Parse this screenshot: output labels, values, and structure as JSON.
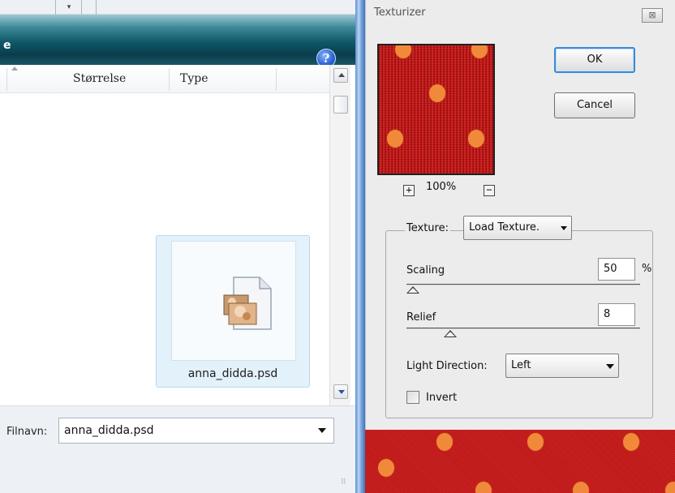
{
  "file_dialog": {
    "title_fragment": "e",
    "help_glyph": "?",
    "columns": {
      "size": "Størrelse",
      "type": "Type"
    },
    "file": {
      "name": "anna_didda.psd",
      "icon": "psd-file-icon"
    },
    "filename_label": "Filnavn:",
    "filename_value": "anna_didda.psd"
  },
  "texturizer": {
    "title": "Texturizer",
    "close_glyph": "⊠",
    "zoom": "100%",
    "zoom_plus": "+",
    "zoom_minus": "−",
    "ok": "OK",
    "cancel": "Cancel",
    "texture_label": "Texture:",
    "texture_value": "Load Texture.",
    "scaling_label": "Scaling",
    "scaling_value": "50",
    "scaling_unit": "%",
    "relief_label": "Relief",
    "relief_value": "8",
    "light_label": "Light Direction:",
    "light_value": "Left",
    "invert_label": "Invert",
    "invert_checked": false
  },
  "colors": {
    "preview_red": "#c41414",
    "dot_orange": "#f08a3a",
    "title_teal": "#0f5767",
    "ok_focus": "#3a8ad6"
  }
}
